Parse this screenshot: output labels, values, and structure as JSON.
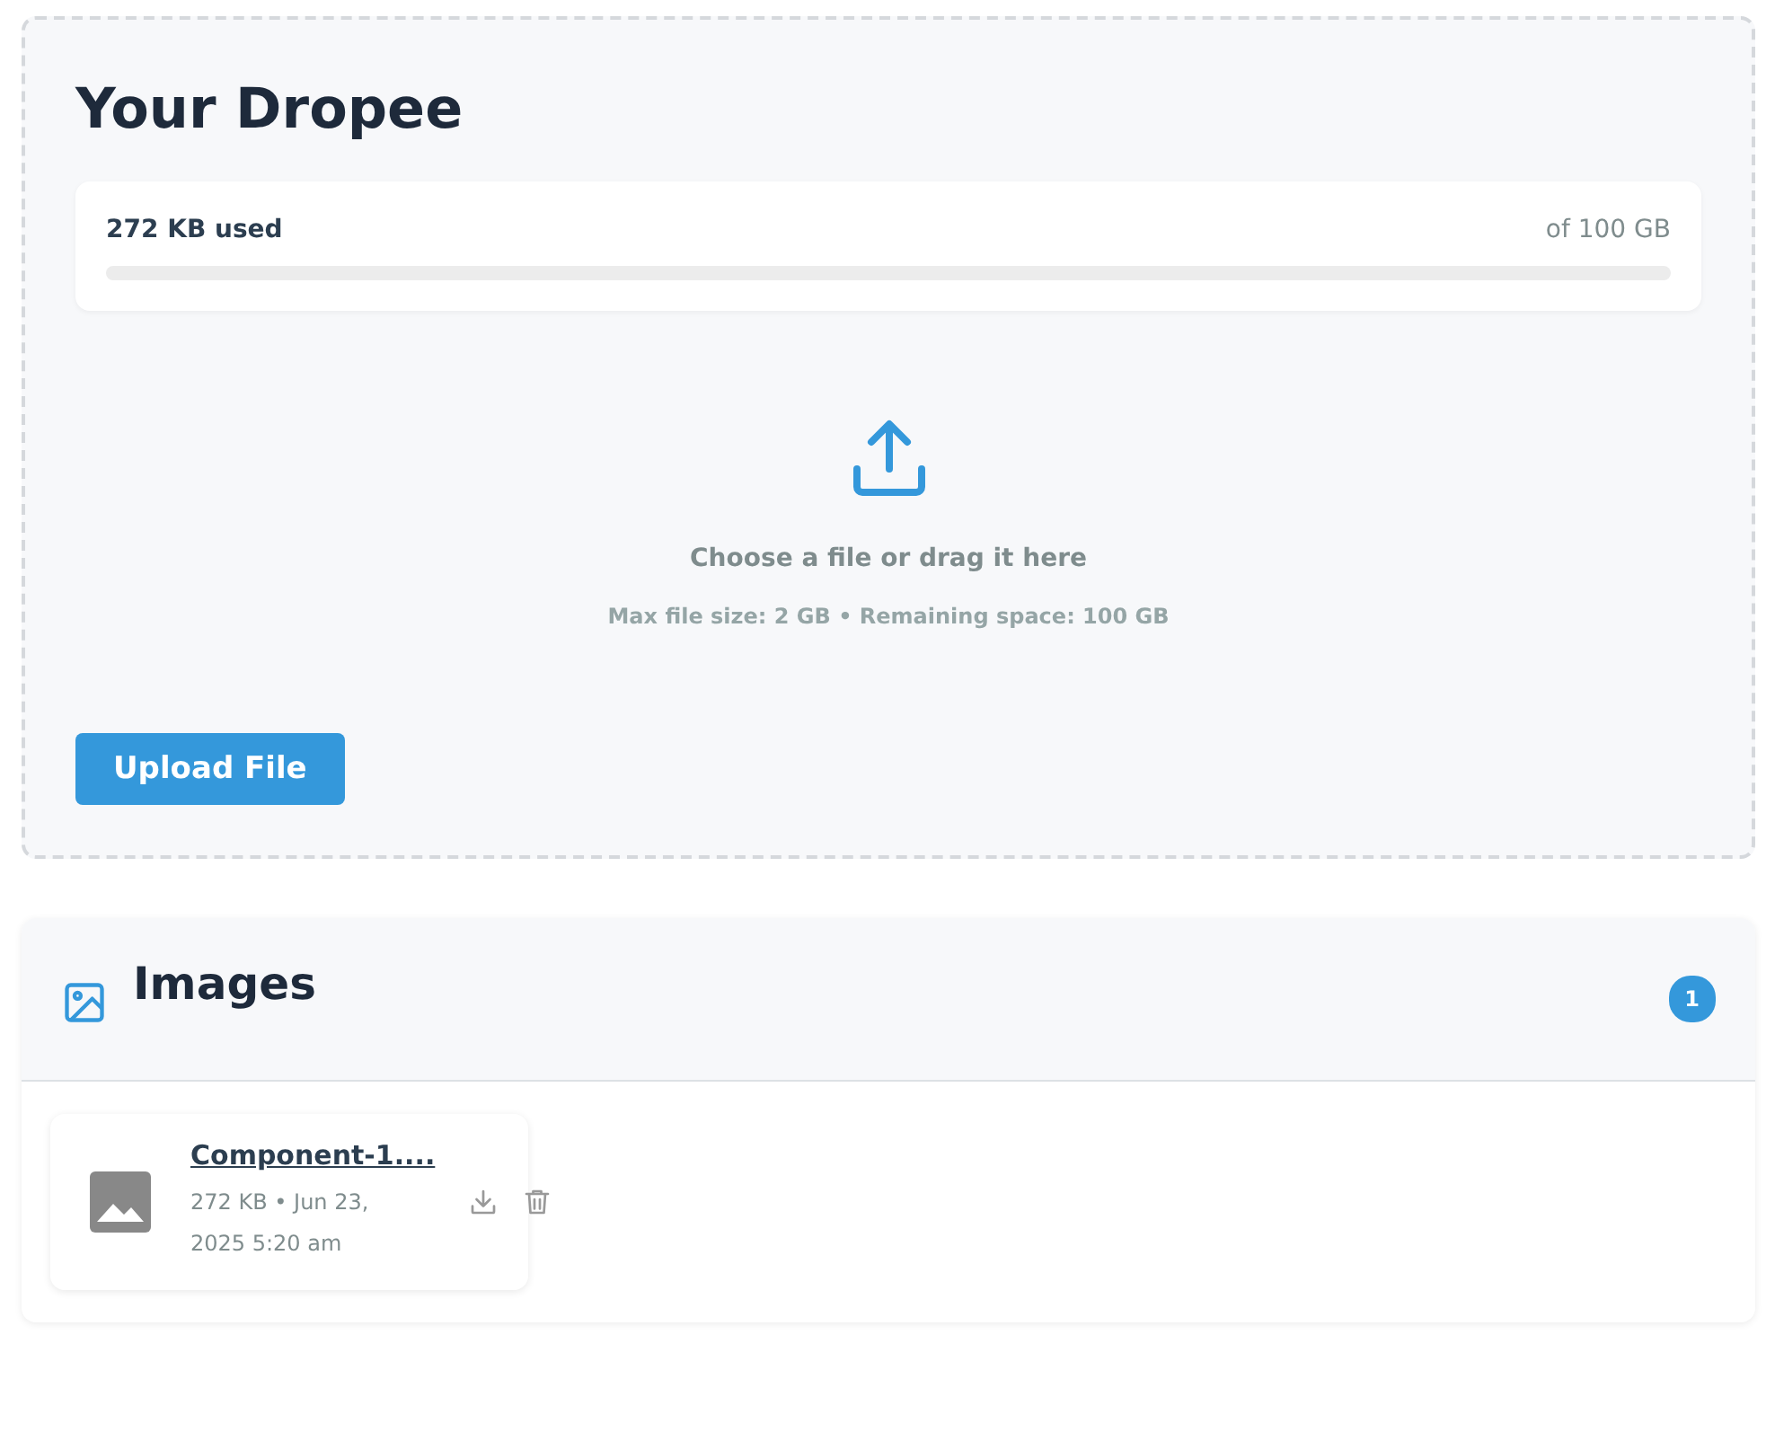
{
  "title": "Your Dropee",
  "storage": {
    "used": "272 KB used",
    "total": "of 100 GB"
  },
  "dropzone": {
    "prompt": "Choose a file or drag it here",
    "limits": "Max file size: 2 GB • Remaining space: 100 GB"
  },
  "upload_button": "Upload File",
  "sections": [
    {
      "title": "Images",
      "count": "1",
      "files": [
        {
          "kind": "image",
          "name": "Component-1....",
          "meta": "272 KB • Jun 23, 2025 5:20 am"
        }
      ]
    }
  ]
}
